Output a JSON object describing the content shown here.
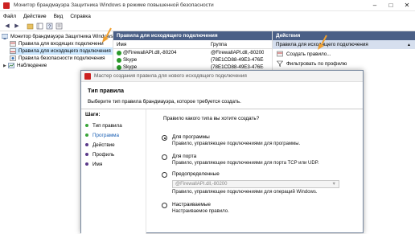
{
  "window": {
    "title": "Монитор брандмауэра Защитника Windows в режиме повышенной безопасности"
  },
  "menu": [
    "Файл",
    "Действие",
    "Вид",
    "Справка"
  ],
  "tree": {
    "root": "Монитор брандмауэра Защитника Windows в",
    "items": [
      "Правила для входящих подключени",
      "Правила для исходящего подключения",
      "Правила безопасности подключения",
      "Наблюдение"
    ]
  },
  "center": {
    "header": "Правила для исходящего подключения",
    "col_name": "Имя",
    "col_group": "Группа",
    "rows": [
      {
        "name": "@FirewallAPI.dll,-80204",
        "group": "@FirewallAPI.dll,-80200"
      },
      {
        "name": "Skype",
        "group": "{78E1CD88-49E3-476E-B"
      },
      {
        "name": "Skype",
        "group": "{78E1CD88-49E3-476E-B"
      }
    ]
  },
  "actions": {
    "header": "Действия",
    "sub": "Правила для исходящего подключения",
    "items": [
      "Создать правило...",
      "Фильтровать по профилю"
    ]
  },
  "wizard": {
    "title": "Мастер создания правила для нового исходящего подключения",
    "heading": "Тип правила",
    "subheading": "Выберите тип правила брандмауэра, которое требуется создать.",
    "steps_title": "Шаги:",
    "steps": [
      "Тип правила",
      "Программа",
      "Действие",
      "Профиль",
      "Имя"
    ],
    "question": "Правило какого типа вы хотите создать?",
    "options": [
      {
        "label": "Для программы",
        "desc": "Правило, управляющее подключениями для программы."
      },
      {
        "label": "Для порта",
        "desc": "Правило, управляющее подключениями для порта TCP или UDP."
      },
      {
        "label": "Предопределенные",
        "desc": "Правило, управляющее подключениями для операций Windows."
      },
      {
        "label": "Настраиваемые",
        "desc": "Настраиваемое правило."
      }
    ],
    "combo_value": "@FirewallAPI.dll,-80200"
  },
  "colors": {
    "header_bg": "#4a5f86",
    "selected_bg": "#cce8ff",
    "arrow": "#f0a030",
    "step_active": "#3aa53a",
    "step_pending": "#5a3a8a"
  }
}
